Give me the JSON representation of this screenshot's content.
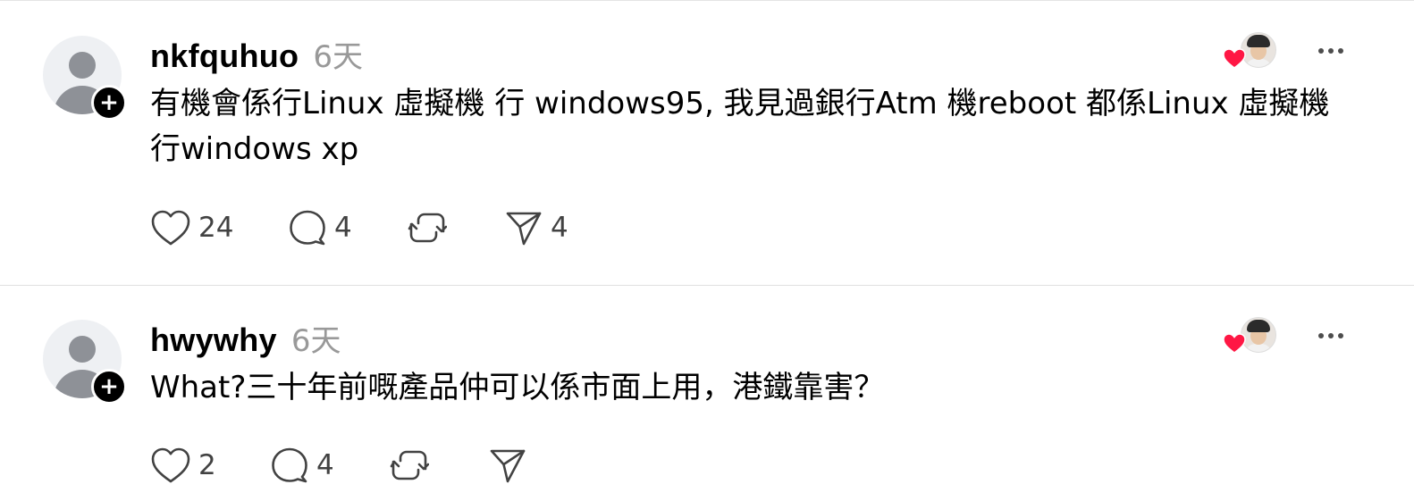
{
  "feed": {
    "posts": [
      {
        "username": "nkfquhuo",
        "timestamp": "6天",
        "body": "有機會係行Linux 虛擬機 行 windows95, 我見過銀行Atm 機reboot 都係Linux 虛擬機 行windows xp",
        "likes": "24",
        "replies": "4",
        "shares": "4",
        "icons": {
          "avatar": "default-avatar-icon",
          "follow": "plus-icon",
          "liked_by": "liked-by-avatar",
          "more": "more-dots-icon",
          "like": "heart-icon",
          "reply": "comment-bubble-icon",
          "repost": "repost-icon",
          "share": "send-icon"
        }
      },
      {
        "username": "hwywhy",
        "timestamp": "6天",
        "body": "What?三十年前嘅產品仲可以係市面上用，港鐵靠害？",
        "likes": "2",
        "replies": "4",
        "shares": "",
        "icons": {
          "avatar": "default-avatar-icon",
          "follow": "plus-icon",
          "liked_by": "liked-by-avatar",
          "more": "more-dots-icon",
          "like": "heart-icon",
          "reply": "comment-bubble-icon",
          "repost": "repost-icon",
          "share": "send-icon"
        }
      }
    ],
    "follow_symbol": "+"
  },
  "colors": {
    "heart_badge": "#ff1744",
    "timestamp": "#999999",
    "icon": "#424242",
    "divider": "#e0e0e0"
  }
}
